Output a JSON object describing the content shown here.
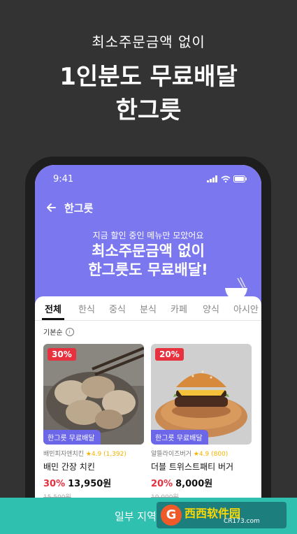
{
  "promo": {
    "subtitle": "최소주문금액 없이",
    "title_line1": "1인분도 무료배달",
    "title_line2": "한그릇"
  },
  "status_bar": {
    "time": "9:41"
  },
  "appbar": {
    "back_icon": "arrow-left-icon",
    "title": "한그릇"
  },
  "hero": {
    "subtitle": "지금 할인 중인 메뉴만 모았어요",
    "title_line1": "최소주문금액 없이",
    "title_line2": "한그릇도 무료배달!"
  },
  "tabs": [
    "전체",
    "한식",
    "중식",
    "분식",
    "카페",
    "양식",
    "아시안"
  ],
  "active_tab": "전체",
  "sort": {
    "label": "기본순",
    "info_icon": "i"
  },
  "products": [
    {
      "discount_badge": "30%",
      "free_badge": "한그릇 무료배달",
      "store": "배민피자앤치킨",
      "rating": "★4.9 (1,392)",
      "name": "배민 간장 치킨",
      "discount": "30%",
      "price": "13,950원",
      "original_price": "15,500원"
    },
    {
      "discount_badge": "20%",
      "free_badge": "한그릇 무료배달",
      "store": "알뜰라이즈버거",
      "rating": "★4.9 (800)",
      "name": "더블 트위스트패티 버거",
      "discount": "20%",
      "price": "8,000원",
      "original_price": "10,000원"
    }
  ],
  "bottom_bar": {
    "text": "일부 지역 및 가"
  },
  "watermark": {
    "logo": "G",
    "text": "西西软件园",
    "url": "CR173.com"
  },
  "colors": {
    "hero": "#7b78ef",
    "accent_red": "#e8313f",
    "free_badge": "#6c67e8",
    "bottom_bar": "#2fc0b0"
  }
}
